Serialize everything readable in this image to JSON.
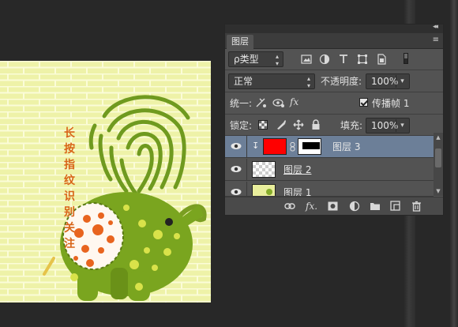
{
  "canvas_text": "长按指纹识别关注",
  "panel": {
    "tab_label": "图层",
    "collapse_glyph": "◂◂",
    "menu_glyph": "≡",
    "filter": {
      "value": "ρ类型",
      "icons": [
        "image-filter-icon",
        "adjustment-filter-icon",
        "type-filter-icon",
        "shape-filter-icon",
        "smart-object-filter-icon",
        "filter-toggle-icon"
      ]
    },
    "blend_mode": "正常",
    "opacity_label": "不透明度:",
    "opacity_value": "100%",
    "unify_label": "统一:",
    "propagate_label": "传播帧 1",
    "lock_label": "锁定:",
    "fill_label": "填充:",
    "fill_value": "100%",
    "layers": [
      {
        "name": "图层 3",
        "selected": true,
        "visible": true,
        "clipped": true,
        "thumb_color": "#ff0000",
        "has_mask": true
      },
      {
        "name": "图层 2",
        "selected": false,
        "visible": true,
        "clipped": false,
        "thumb": "transparent"
      },
      {
        "name": "图层 1",
        "selected": false,
        "visible": true,
        "clipped": false,
        "thumb": "image"
      }
    ],
    "footer_icons": [
      "link-layers-icon",
      "fx-icon",
      "add-mask-icon",
      "adjustment-layer-icon",
      "new-group-icon",
      "new-layer-icon",
      "delete-layer-icon"
    ],
    "footer_fx": "fx."
  },
  "colors": {
    "panel_bg": "#535353",
    "selected_row": "#6c7f98",
    "canvas_text": "#d86418",
    "fingerprint": "#6f9a1f"
  }
}
